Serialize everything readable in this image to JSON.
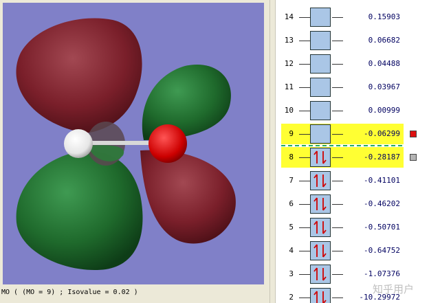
{
  "status_bar": "MO ( (MO = 9) ; Isovalue = 0.02 )",
  "colors": {
    "viewer_background": "#8080c8",
    "positive_lobe": "#7a1f2a",
    "negative_lobe": "#1f6a2c",
    "oxygen_atom": "#cc0000",
    "hydrogen_atom": "#f0f0f0",
    "orbital_box": "#aac6e6",
    "highlight": "#ffff33",
    "homo_lumo_divider": "#22aa66"
  },
  "levels": [
    {
      "index": "14",
      "energy": "0.15903",
      "occupied": false,
      "highlighted": false
    },
    {
      "index": "13",
      "energy": "0.06682",
      "occupied": false,
      "highlighted": false
    },
    {
      "index": "12",
      "energy": "0.04488",
      "occupied": false,
      "highlighted": false
    },
    {
      "index": "11",
      "energy": "0.03967",
      "occupied": false,
      "highlighted": false
    },
    {
      "index": "10",
      "energy": "0.00999",
      "occupied": false,
      "highlighted": false
    },
    {
      "index": "9",
      "energy": "-0.06299",
      "occupied": false,
      "highlighted": true,
      "marker_color": "#dd1111"
    },
    {
      "index": "8",
      "energy": "-0.28187",
      "occupied": true,
      "highlighted": true,
      "marker_color": "#b4b4b4"
    },
    {
      "index": "7",
      "energy": "-0.41101",
      "occupied": true,
      "highlighted": false
    },
    {
      "index": "6",
      "energy": "-0.46202",
      "occupied": true,
      "highlighted": false
    },
    {
      "index": "5",
      "energy": "-0.50701",
      "occupied": true,
      "highlighted": false
    },
    {
      "index": "4",
      "energy": "-0.64752",
      "occupied": true,
      "highlighted": false
    },
    {
      "index": "3",
      "energy": "-1.07376",
      "occupied": true,
      "highlighted": false
    },
    {
      "index": "2",
      "energy": "-10.29972",
      "occupied": true,
      "highlighted": false
    }
  ],
  "watermark": "知乎用户"
}
